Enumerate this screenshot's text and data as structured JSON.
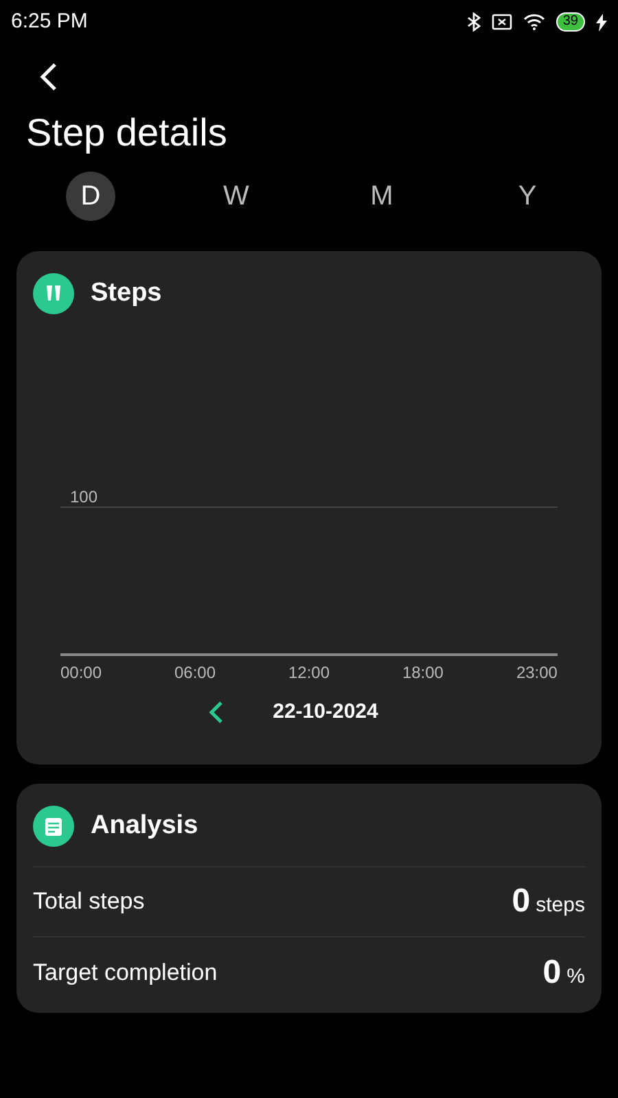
{
  "status_bar": {
    "time": "6:25 PM",
    "battery": "39"
  },
  "title": "Step details",
  "tabs": [
    {
      "label": "D",
      "selected": true
    },
    {
      "label": "W",
      "selected": false
    },
    {
      "label": "M",
      "selected": false
    },
    {
      "label": "Y",
      "selected": false
    }
  ],
  "steps_card": {
    "title": "Steps",
    "chart": {
      "gridline_label": "100",
      "time_labels": [
        "00:00",
        "06:00",
        "12:00",
        "18:00",
        "23:00"
      ]
    },
    "date": "22-10-2024"
  },
  "analysis_card": {
    "title": "Analysis",
    "rows": [
      {
        "label": "Total steps",
        "value": "0",
        "unit": "steps"
      },
      {
        "label": "Target completion",
        "value": "0",
        "unit": "%"
      }
    ]
  }
}
